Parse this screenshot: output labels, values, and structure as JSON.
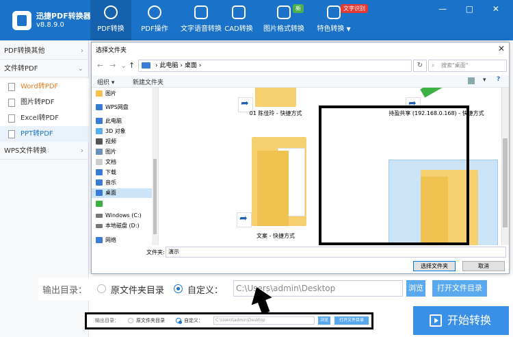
{
  "app": {
    "name": "迅捷PDF转换器",
    "version": "v8.8.9.0"
  },
  "toolbar": [
    {
      "label": "PDF转换",
      "icon": "convert-icon"
    },
    {
      "label": "PDF操作",
      "icon": "gear-icon"
    },
    {
      "label": "文字语音转换",
      "icon": "audio-wave-icon"
    },
    {
      "label": "CAD转换",
      "icon": "cad-icon"
    },
    {
      "label": "图片格式转换",
      "icon": "image-icon",
      "badge": "新"
    },
    {
      "label": "特色转换",
      "icon": "special-icon",
      "badge": "文字识别",
      "dropdown": "▼"
    }
  ],
  "window_controls": "— □ ✕",
  "sidebar": {
    "groups": [
      {
        "label": "PDF转换其他",
        "chevron": "›"
      },
      {
        "label": "文件转PDF",
        "chevron": "⌄",
        "items": [
          "Word转PDF",
          "图片转PDF",
          "Excel转PDF",
          "PPT转PDF"
        ]
      },
      {
        "label": "WPS文件转换",
        "chevron": "›"
      }
    ]
  },
  "dialog": {
    "title": "选择文件夹",
    "close": "✕",
    "address": [
      "此电脑",
      "桌面"
    ],
    "address_sep": "›",
    "search_placeholder": "搜索\"桌面\"",
    "cmd_organize": "组织 ▾",
    "cmd_new_folder": "新建文件夹",
    "nav_items": [
      "图片",
      "WPS网盘",
      "此电脑",
      "3D 对象",
      "视频",
      "图片",
      "文档",
      "下载",
      "音乐",
      "桌面",
      "",
      "Windows (C:)",
      "本地磁盘 (D:)",
      "网络"
    ],
    "files": [
      {
        "name": "01 陈佳玲 - 快捷方式"
      },
      {
        "name": "持盈共享 (192.168.0.168) - 快捷方式"
      },
      {
        "name": "文案 - 快捷方式"
      },
      {
        "name": "演示"
      }
    ],
    "filename_label": "文件夹:",
    "filename_value": "演示",
    "choose_button": "选择文件夹",
    "cancel_button": "取消"
  },
  "output": {
    "label": "输出目录：",
    "option_original": "原文件夹目录",
    "option_custom": "自定义：",
    "path": "C:\\Users\\admin\\Desktop",
    "browse": "浏览",
    "open_folder": "打开文件目录"
  },
  "start_button": "开始转换",
  "colors": {
    "brand": "#1a73c9",
    "accent_orange": "#e67e22",
    "badge_green": "#4caf50",
    "badge_red": "#e53935"
  }
}
